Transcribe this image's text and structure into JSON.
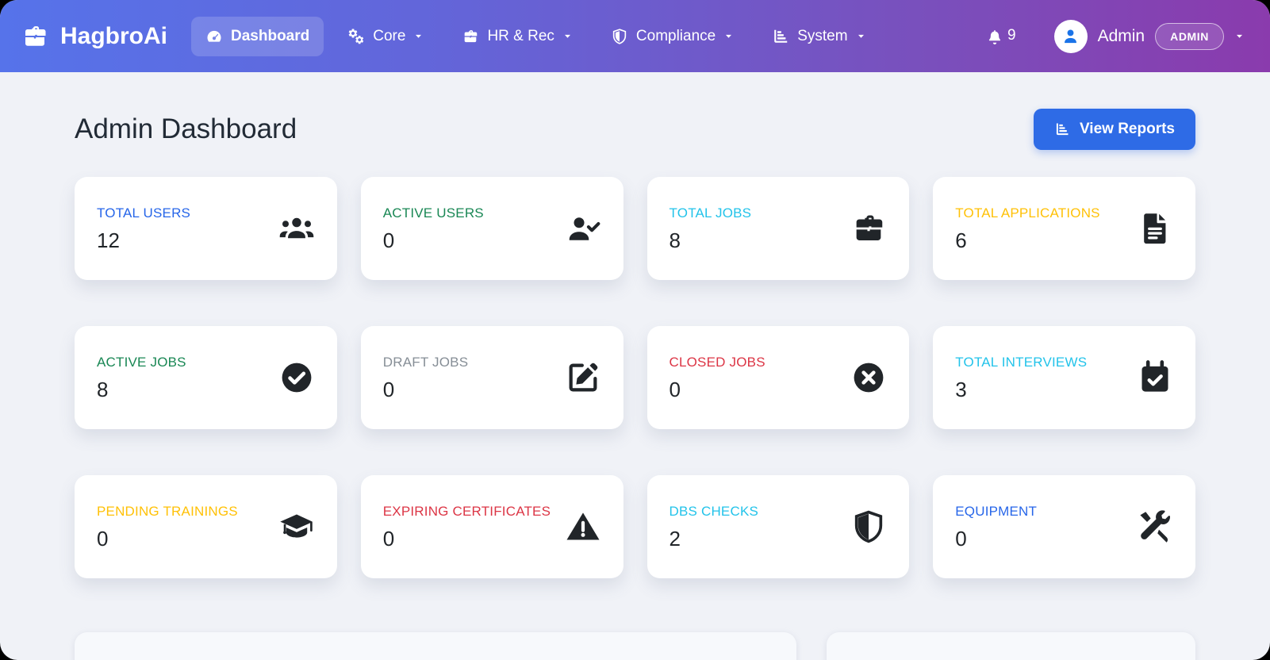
{
  "brand": {
    "name": "HagbroAi",
    "icon": "briefcase-icon"
  },
  "nav": {
    "items": [
      {
        "label": "Dashboard",
        "icon": "gauge-icon",
        "active": true,
        "has_dropdown": false
      },
      {
        "label": "Core",
        "icon": "gears-icon",
        "active": false,
        "has_dropdown": true
      },
      {
        "label": "HR & Rec",
        "icon": "briefcase-icon",
        "active": false,
        "has_dropdown": true
      },
      {
        "label": "Compliance",
        "icon": "shield-icon",
        "active": false,
        "has_dropdown": true
      },
      {
        "label": "System",
        "icon": "chart-bar-icon",
        "active": false,
        "has_dropdown": true
      }
    ],
    "notifications": {
      "icon": "bell-icon",
      "count": "9"
    },
    "user": {
      "name": "Admin",
      "role_badge": "ADMIN",
      "avatar_icon": "user-icon"
    }
  },
  "header": {
    "title": "Admin Dashboard",
    "view_reports_label": "View Reports",
    "view_reports_icon": "chart-bar-icon"
  },
  "cards": [
    {
      "label": "TOTAL USERS",
      "value": "12",
      "icon": "users-icon",
      "label_color": "#2766e9"
    },
    {
      "label": "ACTIVE USERS",
      "value": "0",
      "icon": "user-check-icon",
      "label_color": "#198754"
    },
    {
      "label": "TOTAL JOBS",
      "value": "8",
      "icon": "briefcase-icon",
      "label_color": "#22c3ea"
    },
    {
      "label": "TOTAL APPLICATIONS",
      "value": "6",
      "icon": "file-lines-icon",
      "label_color": "#ffc107"
    },
    {
      "label": "ACTIVE JOBS",
      "value": "8",
      "icon": "check-circle-icon",
      "label_color": "#198754"
    },
    {
      "label": "DRAFT JOBS",
      "value": "0",
      "icon": "pen-square-icon",
      "label_color": "#868e96"
    },
    {
      "label": "CLOSED JOBS",
      "value": "0",
      "icon": "times-circle-icon",
      "label_color": "#dc3545"
    },
    {
      "label": "TOTAL INTERVIEWS",
      "value": "3",
      "icon": "calendar-check-icon",
      "label_color": "#22c3ea"
    },
    {
      "label": "PENDING TRAININGS",
      "value": "0",
      "icon": "graduation-cap-icon",
      "label_color": "#ffc107"
    },
    {
      "label": "EXPIRING CERTIFICATES",
      "value": "0",
      "icon": "warning-triangle-icon",
      "label_color": "#dc3545"
    },
    {
      "label": "DBS CHECKS",
      "value": "2",
      "icon": "shield-halved-icon",
      "label_color": "#22c3ea"
    },
    {
      "label": "EQUIPMENT",
      "value": "0",
      "icon": "tools-icon",
      "label_color": "#2766e9"
    }
  ],
  "colors": {
    "navbar_gradient": [
      "#5673ea",
      "#8a3bad"
    ],
    "content_background": "#f0f2f7",
    "button_blue": "#2e6be6",
    "card_background": "#ffffff",
    "card_icon_color": "#212529",
    "value_color": "#212529",
    "avatar_person_blue": "#1a73e8"
  }
}
